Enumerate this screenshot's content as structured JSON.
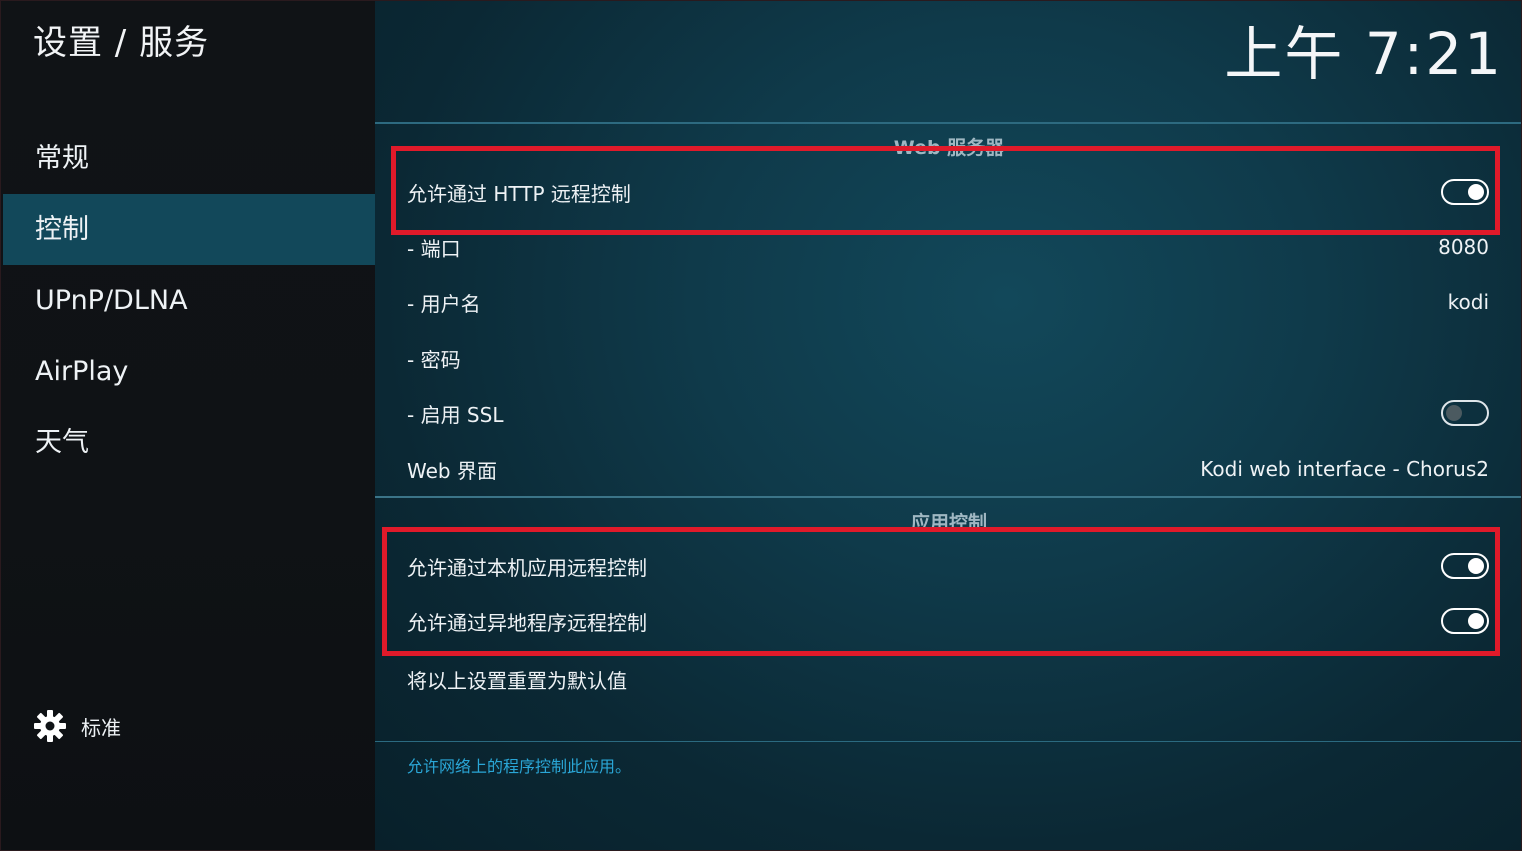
{
  "header": {
    "title": "设置 / 服务",
    "clock": "上午 7:21"
  },
  "sidebar": {
    "items": [
      {
        "label": "常规"
      },
      {
        "label": "控制"
      },
      {
        "label": "UPnP/DLNA"
      },
      {
        "label": "AirPlay"
      },
      {
        "label": "天气"
      }
    ],
    "active_index": 1,
    "level_label": "标准",
    "level_icon": "gear-icon"
  },
  "sections": {
    "web_server": {
      "title": "Web 服务器",
      "allow_http": {
        "label": "允许通过 HTTP 远程控制",
        "enabled": true
      },
      "port": {
        "label": "- 端口",
        "value": "8080"
      },
      "username": {
        "label": "- 用户名",
        "value": "kodi"
      },
      "password": {
        "label": "- 密码"
      },
      "ssl": {
        "label": "- 启用 SSL",
        "enabled": false
      },
      "web_interface": {
        "label": "Web 界面",
        "value": "Kodi web interface - Chorus2"
      }
    },
    "app_control": {
      "title": "应用控制",
      "allow_local": {
        "label": "允许通过本机应用远程控制",
        "enabled": true
      },
      "allow_remote": {
        "label": "允许通过异地程序远程控制",
        "enabled": true
      },
      "reset": {
        "label": "将以上设置重置为默认值"
      }
    }
  },
  "footer": {
    "hint": "允许网络上的程序控制此应用。"
  },
  "colors": {
    "accent": "#12485a",
    "highlight": "#e01a2a",
    "hint": "#2aa6d6"
  }
}
